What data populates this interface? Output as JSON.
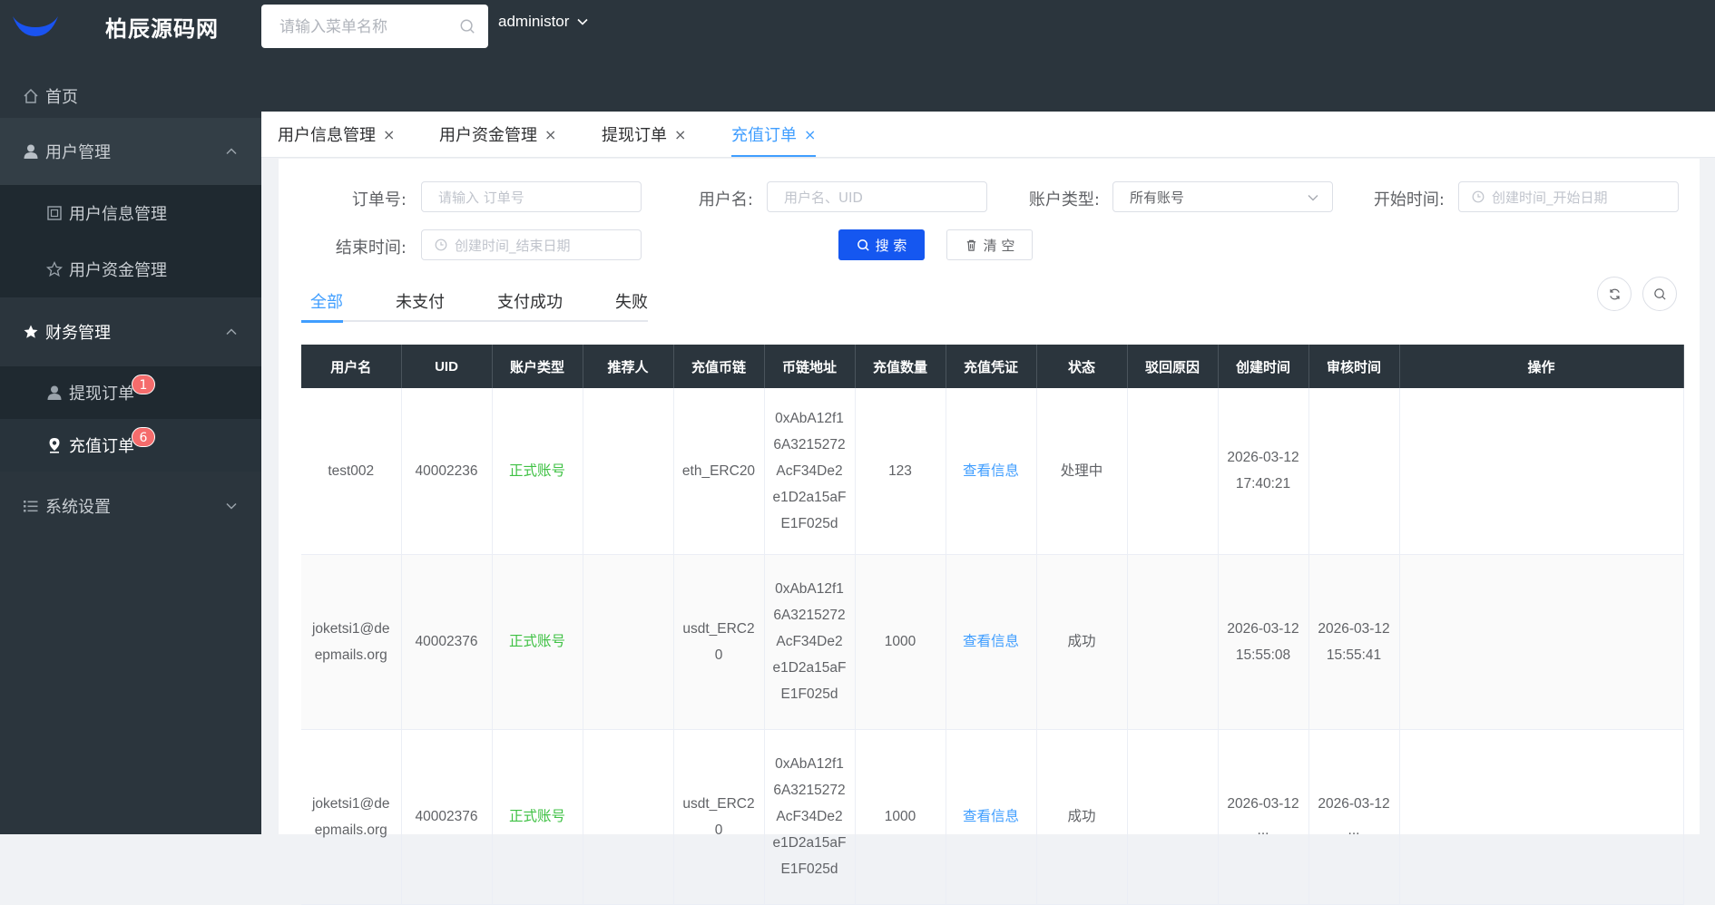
{
  "app": {
    "title": "柏辰源码网"
  },
  "header": {
    "search_placeholder": "请输入菜单名称",
    "user": "administor"
  },
  "sidebar": {
    "home": "首页",
    "groups": [
      {
        "label": "用户管理",
        "items": [
          "用户信息管理",
          "用户资金管理"
        ]
      },
      {
        "label": "财务管理",
        "items": [
          "提现订单",
          "充值订单"
        ]
      },
      {
        "label": "系统设置"
      }
    ],
    "badges": {
      "withdraw": "1",
      "recharge": "6"
    }
  },
  "tabs": [
    {
      "label": "用户信息管理",
      "close": "×"
    },
    {
      "label": "用户资金管理",
      "close": "×"
    },
    {
      "label": "提现订单",
      "close": "×"
    },
    {
      "label": "充值订单",
      "close": "×"
    }
  ],
  "filters": {
    "order_no_label": "订单号:",
    "order_no_placeholder": "请输入 订单号",
    "username_label": "用户名:",
    "username_placeholder": "用户名、UID",
    "account_type_label": "账户类型:",
    "account_type_value": "所有账号",
    "start_label": "开始时间:",
    "start_placeholder": "创建时间_开始日期",
    "end_label": "结束时间:",
    "end_placeholder": "创建时间_结束日期",
    "search_btn": "搜 索",
    "clear_btn": "清 空"
  },
  "status_tabs": [
    "全部",
    "未支付",
    "支付成功",
    "失败"
  ],
  "table": {
    "headers": [
      "用户名",
      "UID",
      "账户类型",
      "推荐人",
      "充值币链",
      "币链地址",
      "充值数量",
      "充值凭证",
      "状态",
      "驳回原因",
      "创建时间",
      "审核时间",
      "操作"
    ],
    "rows": [
      {
        "username": "test002",
        "uid": "40002236",
        "type": "正式账号",
        "referrer": "",
        "chain": "eth_ERC20",
        "address": "0xAbA12f16A3215272AcF34De2e1D2a15aFE1F025d",
        "amount": "123",
        "proof": "查看信息",
        "status": "处理中",
        "reason": "",
        "created": "2026-03-12 17:40:21",
        "reviewed": "",
        "ops": ""
      },
      {
        "username": "joketsi1@deepmails.org",
        "uid": "40002376",
        "type": "正式账号",
        "referrer": "",
        "chain": "usdt_ERC20",
        "address": "0xAbA12f16A3215272AcF34De2e1D2a15aFE1F025d",
        "amount": "1000",
        "proof": "查看信息",
        "status": "成功",
        "reason": "",
        "created": "2026-03-12 15:55:08",
        "reviewed": "2026-03-12 15:55:41",
        "ops": ""
      },
      {
        "username": "joketsi1@deepmails.org",
        "uid": "40002376",
        "type": "正式账号",
        "referrer": "",
        "chain": "usdt_ERC20",
        "address": "0xAbA12f16A3215272AcF34De2e1D2a15aFE1F025d",
        "amount": "1000",
        "proof": "查看信息",
        "status": "成功",
        "reason": "",
        "created": "2026-03-12 ...",
        "reviewed": "2026-03-12 ...",
        "ops": ""
      }
    ]
  },
  "colors": {
    "header_bg": "#2b353d",
    "accent": "#409eff",
    "primary_button": "#1557f0",
    "badge": "#f56c6c",
    "success_text": "#3fc144"
  }
}
